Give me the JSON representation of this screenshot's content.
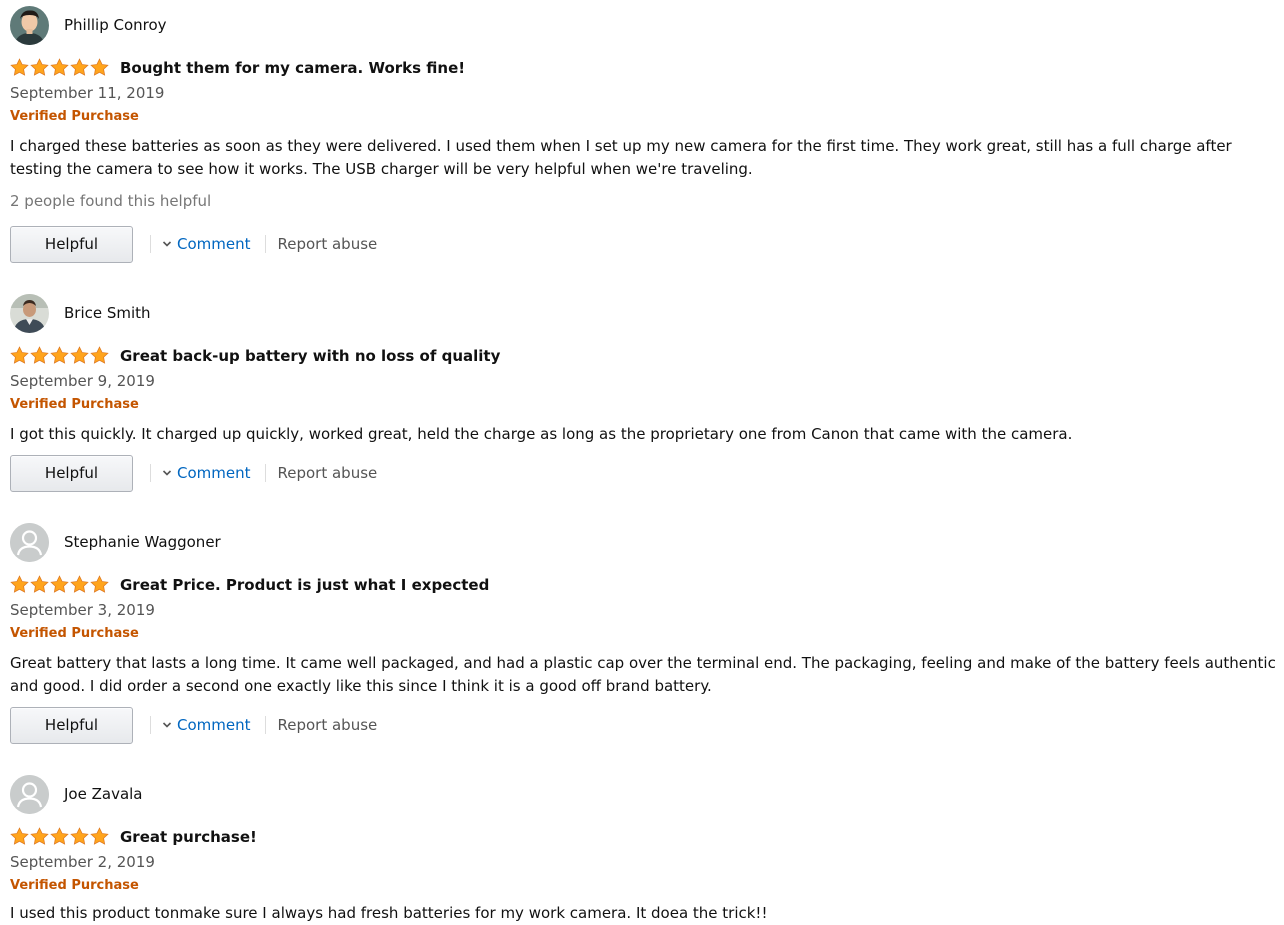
{
  "reviews": [
    {
      "profile_name": "Phillip Conroy",
      "avatar": "user-photo",
      "rating": 5,
      "title": "Bought them for my camera. Works fine!",
      "date": "September 11, 2019",
      "verified": "Verified Purchase",
      "body": "I charged these batteries as soon as they were delivered. I used them when I set up my new camera for the first time. They work great, still has a full charge after testing the camera to see how it works. The USB charger will be very helpful when we're traveling.",
      "helpful_count": "2 people found this helpful",
      "helpful_label": "Helpful",
      "comment_label": "Comment",
      "report_label": "Report abuse"
    },
    {
      "profile_name": "Brice Smith",
      "avatar": "user-photo",
      "rating": 5,
      "title": "Great back-up battery with no loss of quality",
      "date": "September 9, 2019",
      "verified": "Verified Purchase",
      "body": "I got this quickly. It charged up quickly, worked great, held the charge as long as the proprietary one from Canon that came with the camera.",
      "helpful_label": "Helpful",
      "comment_label": "Comment",
      "report_label": "Report abuse"
    },
    {
      "profile_name": "Stephanie Waggoner",
      "avatar": "default-avatar",
      "rating": 5,
      "title": "Great Price. Product is just what I expected",
      "date": "September 3, 2019",
      "verified": "Verified Purchase",
      "body": "Great battery that lasts a long time. It came well packaged, and had a plastic cap over the terminal end. The packaging, feeling and make of the battery feels authentic and good. I did order a second one exactly like this since I think it is a good off brand battery.",
      "helpful_label": "Helpful",
      "comment_label": "Comment",
      "report_label": "Report abuse"
    },
    {
      "profile_name": "Joe Zavala",
      "avatar": "default-avatar",
      "rating": 5,
      "title": "Great purchase!",
      "date": "September 2, 2019",
      "verified": "Verified Purchase",
      "body": "I used this product tonmake sure I always had fresh batteries for my work camera. It doea the trick!!"
    }
  ],
  "colors": {
    "star": "#ffa41c",
    "verified": "#c45500",
    "link": "#0066c0",
    "muted": "#767676"
  },
  "icons": {
    "star": "star-icon",
    "chevron": "chevron-down-icon",
    "avatar_default": "person-icon"
  }
}
